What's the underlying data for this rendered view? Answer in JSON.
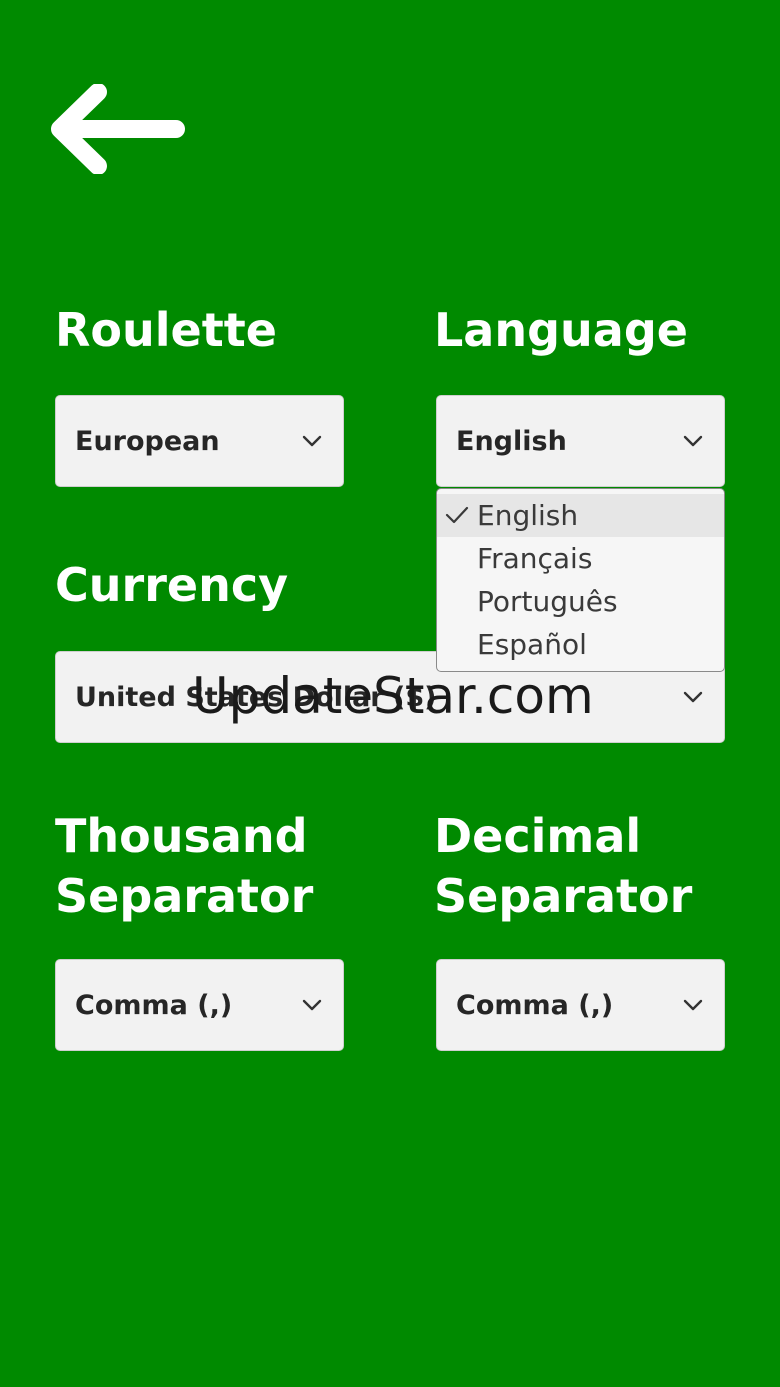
{
  "header": {
    "back_icon": "arrow-left-icon"
  },
  "roulette": {
    "label": "Roulette",
    "value": "European"
  },
  "language": {
    "label": "Language",
    "value": "English",
    "options": [
      "English",
      "Français",
      "Português",
      "Español"
    ],
    "selected": "English"
  },
  "currency": {
    "label": "Currency",
    "value": "United States Dollar ($)"
  },
  "thousand": {
    "label_line1": "Thousand",
    "label_line2": "Separator",
    "value": "Comma (,)"
  },
  "decimal": {
    "label_line1": "Decimal",
    "label_line2": "Separator",
    "value": "Comma (,)"
  },
  "watermark": "UpdateStar.com",
  "colors": {
    "background": "#008a00",
    "heading": "#ffffff",
    "select_bg": "#f2f2f2"
  }
}
